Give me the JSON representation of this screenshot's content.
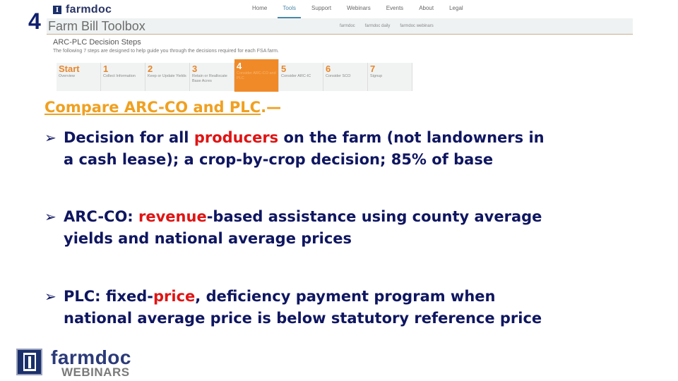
{
  "slide": {
    "number": "4"
  },
  "website": {
    "brand": {
      "mark": "I",
      "name": "farmdoc"
    },
    "top_nav": [
      {
        "label": "Home",
        "active": false
      },
      {
        "label": "Tools",
        "active": true
      },
      {
        "label": "Support",
        "active": false
      },
      {
        "label": "Webinars",
        "active": false
      },
      {
        "label": "Events",
        "active": false
      },
      {
        "label": "About",
        "active": false
      },
      {
        "label": "Legal",
        "active": false
      }
    ],
    "toolbox_title": "Farm Bill Toolbox",
    "sub_nav": [
      {
        "label": "farmdoc"
      },
      {
        "label": "farmdoc daily"
      },
      {
        "label": "farmdoc webinars"
      }
    ],
    "steps_title": "ARC-PLC Decision Steps",
    "steps_description": "The following 7 steps are designed to help guide you through the decisions required for each FSA farm.",
    "steps": [
      {
        "num": "Start",
        "label": "Overview",
        "active": false
      },
      {
        "num": "1",
        "label": "Collect Information",
        "active": false
      },
      {
        "num": "2",
        "label": "Keep or Update Yields",
        "active": false
      },
      {
        "num": "3",
        "label": "Retain or Reallocate Base Acres",
        "active": false
      },
      {
        "num": "4",
        "label": "Consider ARC-CO and PLC",
        "active": true
      },
      {
        "num": "5",
        "label": "Consider ARC-IC",
        "active": false
      },
      {
        "num": "6",
        "label": "Consider SCO",
        "active": false
      },
      {
        "num": "7",
        "label": "Signup",
        "active": false
      }
    ],
    "accent_color": "#f08a28"
  },
  "content": {
    "heading_link": "Compare ARC-CO and PLC",
    "heading_suffix": ".—",
    "bullet_marker": "➢",
    "bullets": [
      {
        "pre": "Decision for all ",
        "highlight": "producers",
        "post": " on the farm (not landowners in",
        "line2": "a cash lease); a crop-by-crop decision; 85% of base"
      },
      {
        "pre": "ARC-CO:  ",
        "highlight": "revenue",
        "post": "-based assistance using county average",
        "line2": "yields and national average prices"
      },
      {
        "pre": "PLC:  fixed-",
        "highlight": "price",
        "post": ", deficiency payment program when",
        "line2": "national average price is below statutory reference price"
      }
    ],
    "colors": {
      "heading": "#f0a020",
      "text": "#0f1660",
      "highlight": "#e01414"
    }
  },
  "footer": {
    "logo_line1": "farmdoc",
    "logo_line2": "WEBINARS"
  }
}
